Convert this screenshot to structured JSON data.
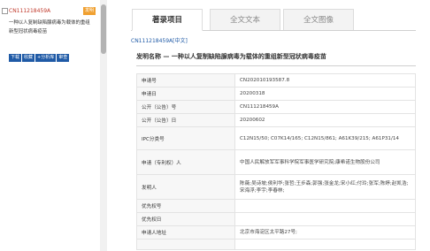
{
  "sidebar": {
    "result": {
      "id": "CN111218459A",
      "badge": "发明",
      "title": "一种以人复制缺陷腺病毒为载体的重组新型冠状病毒疫苗"
    },
    "actions": [
      "下载",
      "收藏",
      "+分析库",
      "审查"
    ]
  },
  "tabs": [
    {
      "label": "著录项目"
    },
    {
      "label": "全文文本"
    },
    {
      "label": "全文图像"
    }
  ],
  "publication_ref": "CN111218459A[中文]",
  "patent_title": "发明名称 —  一种以人复制缺陷腺病毒为载体的重组新型冠状病毒疫苗",
  "fields": [
    {
      "key": "申请号",
      "value": "CN202010193587.8"
    },
    {
      "key": "申请日",
      "value": "20200318"
    },
    {
      "key": "公开（公告）号",
      "value": "CN111218459A"
    },
    {
      "key": "公开（公告）日",
      "value": "20200602"
    },
    {
      "key": "IPC分类号",
      "value": "C12N15/50; C07K14/165; C12N15/861; A61K39/215; A61P31/14"
    },
    {
      "key": "申请（专利权）人",
      "value": "中国人民解放军军事科学院军事医学研究院;康希诺生物股份公司"
    },
    {
      "key": "发明人",
      "value": "陈薇;吴诗坡;侯利华;张哲;王步森;郭强;张金龙;宋小红;付玲;张军;陈婷;赵凯浩;宋海浮;李宇;李春林;"
    },
    {
      "key": "优先权号",
      "value": ""
    },
    {
      "key": "优先权日",
      "value": ""
    },
    {
      "key": "申请人地址",
      "value": "北京市海淀区太平路27号;"
    },
    {
      "key": "",
      "value": ""
    }
  ]
}
